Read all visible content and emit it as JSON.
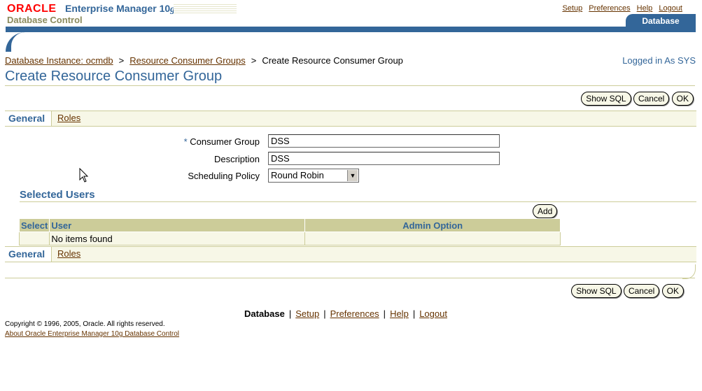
{
  "header": {
    "brand_oracle": "ORACLE",
    "brand_product": "Enterprise Manager 10",
    "brand_product_g": "g",
    "brand_sub": "Database Control",
    "global_links": [
      "Setup",
      "Preferences",
      "Help",
      "Logout"
    ],
    "active_tab": "Database"
  },
  "breadcrumb": {
    "items": [
      "Database Instance: ocmdb",
      "Resource Consumer Groups"
    ],
    "current": "Create Resource Consumer Group",
    "separator": ">"
  },
  "logged_in": "Logged in As SYS",
  "page_title": "Create Resource Consumer Group",
  "buttons": {
    "show_sql": "Show SQL",
    "cancel": "Cancel",
    "ok": "OK",
    "add": "Add"
  },
  "subtabs": {
    "active": "General",
    "other": "Roles"
  },
  "form": {
    "consumer_group_label": "Consumer Group",
    "required_marker": "*",
    "consumer_group_value": "DSS",
    "description_label": "Description",
    "description_value": "DSS",
    "scheduling_label": "Scheduling Policy",
    "scheduling_value": "Round Robin"
  },
  "selected_users": {
    "title": "Selected Users",
    "columns": [
      "Select",
      "User",
      "Admin Option"
    ],
    "empty_text": "No items found"
  },
  "footer": {
    "current": "Database",
    "links": [
      "Setup",
      "Preferences",
      "Help",
      "Logout"
    ],
    "separator": "|",
    "copyright": "Copyright © 1996, 2005, Oracle. All rights reserved.",
    "about": "About Oracle Enterprise Manager 10g Database Control"
  },
  "colors": {
    "brand_blue": "#336699",
    "tan": "#cccc99",
    "light_tan": "#f7f7e7",
    "link": "#663300",
    "oracle_red": "#ff0000"
  }
}
